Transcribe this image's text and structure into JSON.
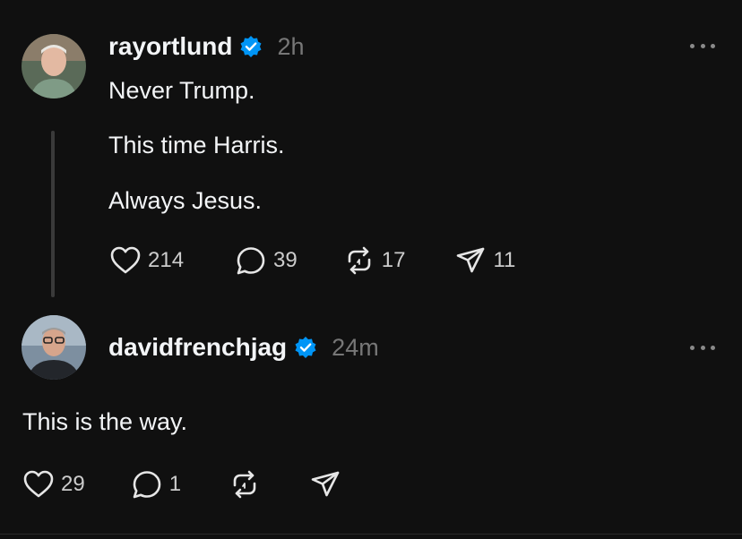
{
  "posts": [
    {
      "username": "rayortlund",
      "time": "2h",
      "lines": [
        "Never Trump.",
        "This time Harris.",
        "Always Jesus."
      ],
      "likes": "214",
      "replies": "39",
      "reposts": "17",
      "shares": "11"
    },
    {
      "username": "davidfrenchjag",
      "time": "24m",
      "lines": [
        "This is the way."
      ],
      "likes": "29",
      "replies": "1"
    }
  ],
  "colors": {
    "background": "#101010",
    "text": "#f3f5f7",
    "muted": "#777777",
    "verified": "#0095f6"
  },
  "icons": [
    "verified-badge-icon",
    "more-icon",
    "heart-icon",
    "comment-icon",
    "repost-icon",
    "send-icon"
  ]
}
